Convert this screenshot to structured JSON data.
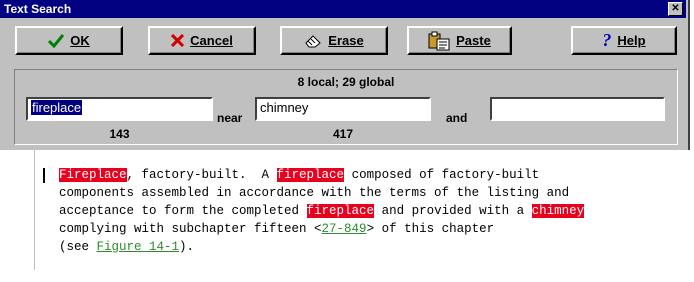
{
  "window": {
    "title": "Text Search",
    "close_label": "✕"
  },
  "toolbar": {
    "ok_label": "OK",
    "cancel_label": "Cancel",
    "erase_label": "Erase",
    "paste_label": "Paste",
    "help_label": "Help"
  },
  "search": {
    "summary": "8 local; 29 global",
    "terms": [
      {
        "value": "fireplace",
        "count": "143"
      },
      {
        "value": "chimney",
        "count": "417"
      },
      {
        "value": "",
        "count": ""
      }
    ],
    "conjunction_1": "near",
    "conjunction_2": "and"
  },
  "document": {
    "line1": {
      "hit1": "Fireplace",
      "t1": ", factory-built.  A ",
      "hit2": "fireplace",
      "t2": " composed of factory-built"
    },
    "line2": "components assembled in accordance with the terms of the listing and",
    "line3": {
      "t1": "acceptance to form the completed ",
      "hit1": "fireplace",
      "t2": " and provided with a ",
      "hit2": "chimney"
    },
    "line4": {
      "t1": "complying with subchapter fifteen <",
      "link": "27-849",
      "t2": "> of this chapter"
    },
    "line5": {
      "t1": "(see ",
      "link": "Figure 14-1",
      "t2": ")."
    }
  },
  "colors": {
    "titlebar": "#000080",
    "highlight": "#e8001c",
    "link": "#2e8b2e",
    "dialog": "#c0c0c0"
  },
  "icons": [
    "check-icon",
    "x-icon",
    "eraser-icon",
    "clipboard-paste-icon",
    "question-icon"
  ]
}
